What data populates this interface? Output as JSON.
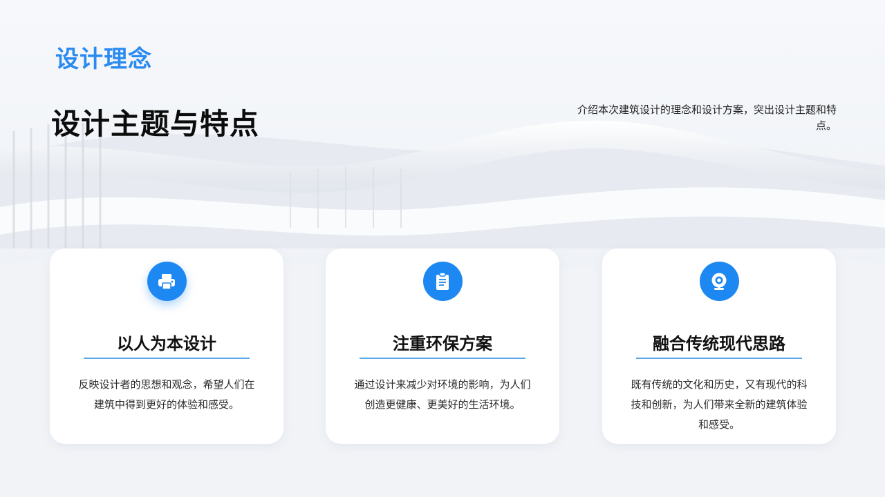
{
  "header": {
    "section_label": "设计理念",
    "title": "设计主题与特点",
    "description": "介绍本次建筑设计的理念和设计方案，突出设计主题和特点。"
  },
  "cards": [
    {
      "icon": "printer-icon",
      "title": "以人为本设计",
      "text": "反映设计者的思想和观念，希望人们在建筑中得到更好的体验和感受。"
    },
    {
      "icon": "clipboard-icon",
      "title": "注重环保方案",
      "text": "通过设计来减少对环境的影响，为人们创造更健康、更美好的生活环境。"
    },
    {
      "icon": "webcam-icon",
      "title": "融合传统现代思路",
      "text": "既有传统的文化和历史，又有现代的科技和创新，为人们带来全新的建筑体验和感受。"
    }
  ],
  "colors": {
    "accent": "#1e88f2",
    "label_blue": "#2a8af0",
    "divider": "#5aa6ea",
    "card_bg": "#ffffff"
  }
}
